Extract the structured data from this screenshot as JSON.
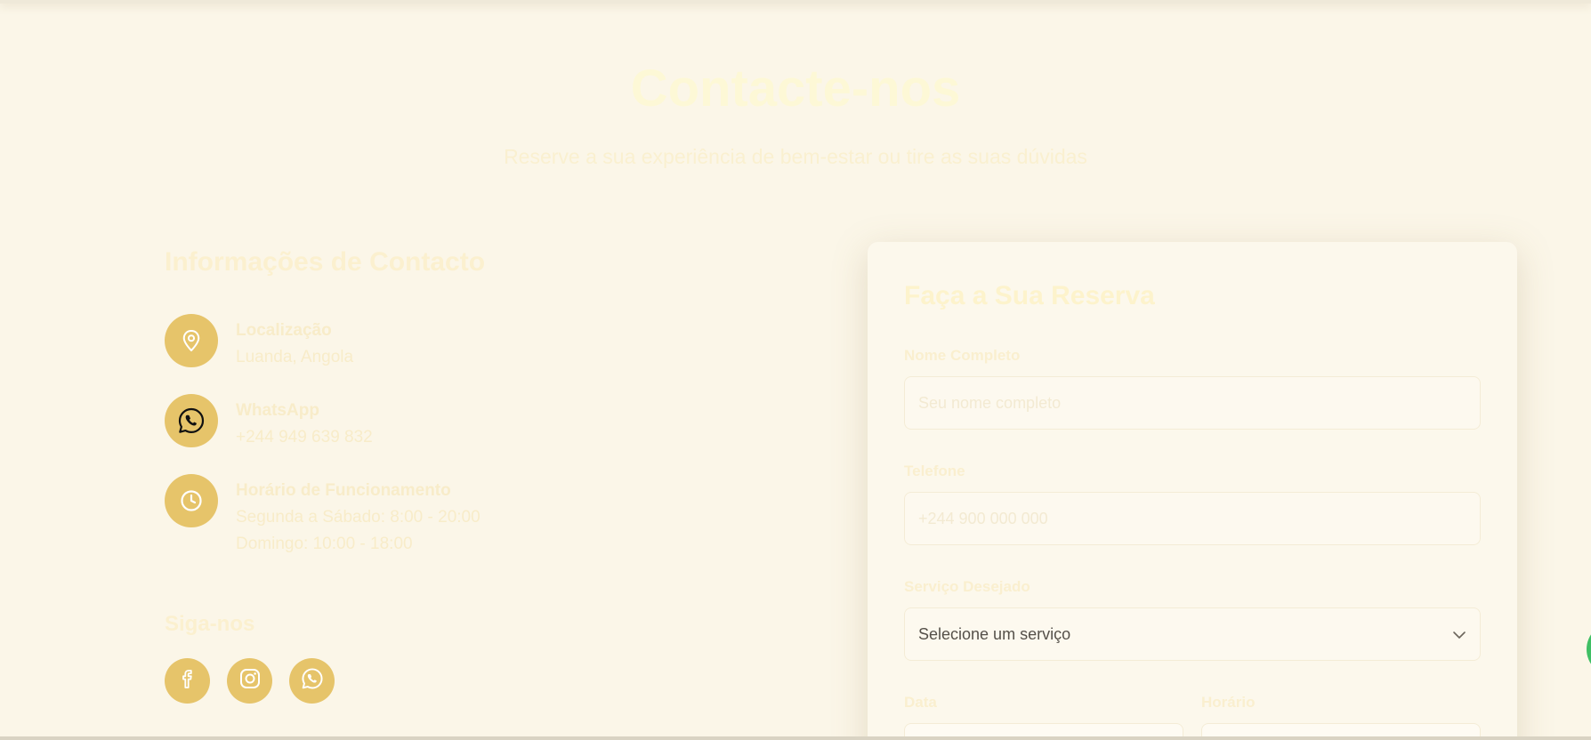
{
  "hero": {
    "title": "Contacte-nos",
    "subtitle": "Reserve a sua experiência de bem-estar ou tire as suas dúvidas"
  },
  "contact_info": {
    "title": "Informações de Contacto",
    "items": [
      {
        "icon": "map-pin-icon",
        "label": "Localização",
        "lines": [
          "Luanda, Angola"
        ]
      },
      {
        "icon": "whatsapp-icon",
        "label": "WhatsApp",
        "lines": [
          "+244 949 639 832"
        ]
      },
      {
        "icon": "clock-icon",
        "label": "Horário de Funcionamento",
        "lines": [
          "Segunda a Sábado: 8:00 - 20:00",
          "Domingo: 10:00 - 18:00"
        ]
      }
    ]
  },
  "follow": {
    "title": "Siga-nos",
    "links": [
      {
        "icon": "facebook-icon"
      },
      {
        "icon": "instagram-icon"
      },
      {
        "icon": "whatsapp-icon"
      }
    ]
  },
  "form": {
    "title": "Faça a Sua Reserva",
    "name": {
      "label": "Nome Completo",
      "placeholder": "Seu nome completo"
    },
    "phone": {
      "label": "Telefone",
      "placeholder": "+244 900 000 000"
    },
    "service": {
      "label": "Serviço Desejado",
      "selected": "Selecione um serviço"
    },
    "date": {
      "label": "Data"
    },
    "time": {
      "label": "Horário"
    }
  },
  "colors": {
    "background": "#fbf6e8",
    "accent": "#e6c46a",
    "card": "#fcf8ec",
    "whatsapp_float": "#3fbf64"
  }
}
